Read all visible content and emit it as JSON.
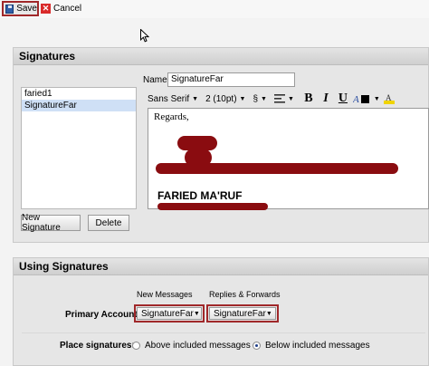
{
  "toolbar": {
    "save_label": "Save",
    "cancel_label": "Cancel"
  },
  "signatures": {
    "title": "Signatures",
    "list": [
      "faried1",
      "SignatureFar"
    ],
    "name_label": "Name:",
    "name_value": "SignatureFar",
    "editor_toolbar": {
      "font": "Sans Serif",
      "size": "2 (10pt)",
      "special": "§",
      "bold": "B",
      "italic": "I",
      "underline": "U"
    },
    "editor_content": {
      "greeting": "Regards,",
      "name": "FARIED MA'RUF"
    },
    "buttons": {
      "new_signature": "New Signature",
      "delete": "Delete"
    }
  },
  "using": {
    "title": "Using Signatures",
    "col_new": "New Messages",
    "col_replies": "Replies & Forwards",
    "primary_label": "Primary Account:",
    "new_value": "SignatureFar",
    "replies_value": "SignatureFar",
    "place_label": "Place signatures:",
    "option_above": "Above included messages",
    "option_below": "Below included messages",
    "selected_option": "below"
  },
  "colors": {
    "highlight_border": "#a0282a",
    "selection": "#cfe0f6",
    "redaction": "#8a0c10"
  }
}
